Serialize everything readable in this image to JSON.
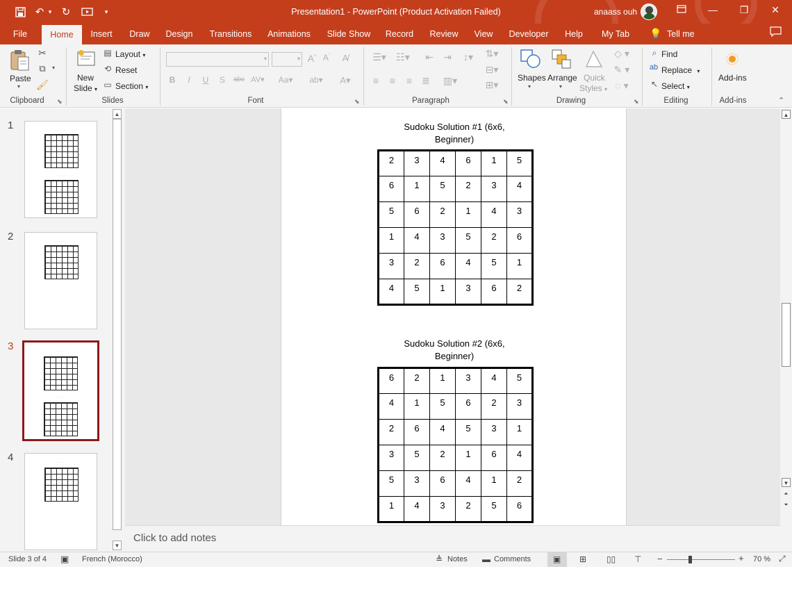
{
  "window": {
    "title": "Presentation1  -  PowerPoint (Product Activation Failed)",
    "user": "anaass ouh"
  },
  "tabs": [
    "File",
    "Home",
    "Insert",
    "Draw",
    "Design",
    "Transitions",
    "Animations",
    "Slide Show",
    "Record",
    "Review",
    "View",
    "Developer",
    "Help",
    "My Tab"
  ],
  "tell_me": "Tell me",
  "ribbon": {
    "clipboard": {
      "label": "Clipboard",
      "paste": "Paste"
    },
    "slides": {
      "label": "Slides",
      "new_slide_line1": "New",
      "new_slide_line2": "Slide",
      "layout": "Layout",
      "reset": "Reset",
      "section": "Section"
    },
    "font": {
      "label": "Font"
    },
    "paragraph": {
      "label": "Paragraph"
    },
    "drawing": {
      "label": "Drawing",
      "shapes": "Shapes",
      "arrange": "Arrange",
      "quick_line1": "Quick",
      "quick_line2": "Styles"
    },
    "editing": {
      "label": "Editing",
      "find": "Find",
      "replace": "Replace",
      "select": "Select"
    },
    "addins": {
      "label": "Add-ins",
      "button": "Add-ins"
    }
  },
  "thumbnails": [
    {
      "num": "1",
      "selected": false
    },
    {
      "num": "2",
      "selected": false
    },
    {
      "num": "3",
      "selected": true
    },
    {
      "num": "4",
      "selected": false
    }
  ],
  "slide": {
    "puzzles": [
      {
        "title_line1": "Sudoku Solution #1 (6x6,",
        "title_line2": "Beginner)",
        "grid": [
          [
            "2",
            "3",
            "4",
            "6",
            "1",
            "5"
          ],
          [
            "6",
            "1",
            "5",
            "2",
            "3",
            "4"
          ],
          [
            "5",
            "6",
            "2",
            "1",
            "4",
            "3"
          ],
          [
            "1",
            "4",
            "3",
            "5",
            "2",
            "6"
          ],
          [
            "3",
            "2",
            "6",
            "4",
            "5",
            "1"
          ],
          [
            "4",
            "5",
            "1",
            "3",
            "6",
            "2"
          ]
        ]
      },
      {
        "title_line1": "Sudoku Solution #2 (6x6,",
        "title_line2": "Beginner)",
        "grid": [
          [
            "6",
            "2",
            "1",
            "3",
            "4",
            "5"
          ],
          [
            "4",
            "1",
            "5",
            "6",
            "2",
            "3"
          ],
          [
            "2",
            "6",
            "4",
            "5",
            "3",
            "1"
          ],
          [
            "3",
            "5",
            "2",
            "1",
            "6",
            "4"
          ],
          [
            "5",
            "3",
            "6",
            "4",
            "1",
            "2"
          ],
          [
            "1",
            "4",
            "3",
            "2",
            "5",
            "6"
          ]
        ]
      }
    ]
  },
  "notes_placeholder": "Click to add notes",
  "statusbar": {
    "slide_info": "Slide 3 of 4",
    "language": "French (Morocco)",
    "notes": "Notes",
    "comments": "Comments",
    "zoom": "70 %"
  },
  "colors": {
    "accent": "#c43e1c",
    "selected_thumb": "#8b1a1a"
  }
}
